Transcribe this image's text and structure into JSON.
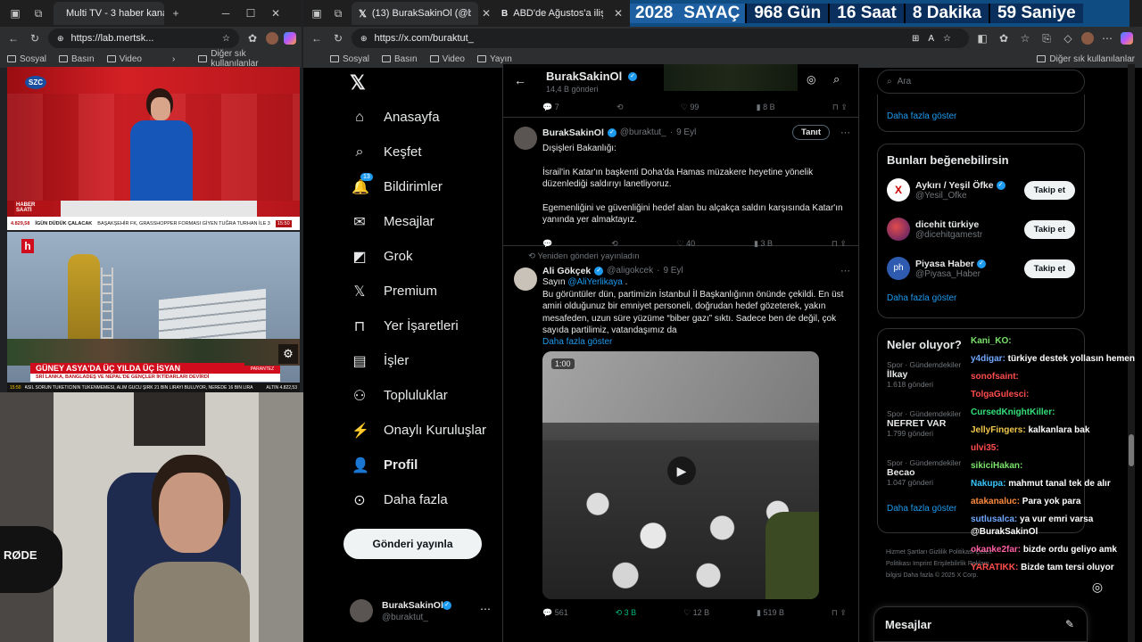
{
  "left_window": {
    "tabs": [
      {
        "label": "Multi TV - 3 haber kanal..."
      }
    ],
    "url": "https://lab.mertsk...",
    "bookmarks": [
      "Sosyal",
      "Basın",
      "Video"
    ],
    "bookmarks_more": "Diğer sık kullanılanlar",
    "tv1": {
      "logo": "SZC",
      "corner_label": "HABER SAATİ",
      "ticker": "İGÜN DÜDÜK ÇALACAK",
      "ticker2": "BAŞAKŞEHİR FK, GRASSHOPPER FORMASI GİYEN TUĞRA TURHAN İLE 3",
      "time": "15:50",
      "index": "4.829,58"
    },
    "tv2": {
      "headline": "GÜNEY ASYA'DA ÜÇ YILDA ÜÇ İSYAN",
      "subhead": "SRİ LANKA, BANGLADEŞ VE NEPAL'DE GENÇLER İKTİDARLARI DEVİRDİ",
      "ticker": "ASIL SORUN TÜKETİCİNİN TÜKENMEMESİ, ALIM GÜCÜ ŞİRK 21 BİN LİRAYI BULUYOR, NEREDE 16 BİN LİRA",
      "time": "15:50",
      "label": "PARANTEZ",
      "gold": "ALTIN 4.822,53"
    },
    "webcam_label": "RØDE"
  },
  "right_window": {
    "tabs": [
      {
        "label": "(13) BurakSakinOl (@buraktut_"
      },
      {
        "label": "ABD'de Ağustos'a ilişkin enfla"
      }
    ],
    "url": "https://x.com/buraktut_",
    "bookmarks": [
      "Sosyal",
      "Basın",
      "Video",
      "Yayın"
    ],
    "bookmarks_more": "Diğer sık kullanılanlar"
  },
  "counter": {
    "year": "2028",
    "label": "SAYAÇ",
    "days": "968 Gün",
    "hours": "16 Saat",
    "minutes": "8 Dakika",
    "seconds": "59 Saniye"
  },
  "x_nav": {
    "items": [
      {
        "label": "Anasayfa",
        "icon": "home-icon"
      },
      {
        "label": "Keşfet",
        "icon": "search-icon"
      },
      {
        "label": "Bildirimler",
        "icon": "bell-icon",
        "badge": "13"
      },
      {
        "label": "Mesajlar",
        "icon": "mail-icon"
      },
      {
        "label": "Grok",
        "icon": "grok-icon"
      },
      {
        "label": "Premium",
        "icon": "x-icon"
      },
      {
        "label": "Yer İşaretleri",
        "icon": "bookmark-icon"
      },
      {
        "label": "İşler",
        "icon": "briefcase-icon"
      },
      {
        "label": "Topluluklar",
        "icon": "people-icon"
      },
      {
        "label": "Onaylı Kuruluşlar",
        "icon": "lightning-icon"
      },
      {
        "label": "Profil",
        "icon": "person-icon"
      },
      {
        "label": "Daha fazla",
        "icon": "more-icon"
      }
    ],
    "post_button": "Gönderi yayınla",
    "account_name": "BurakSakinOl",
    "account_handle": "@buraktut_"
  },
  "profile_header": {
    "name": "BurakSakinOl",
    "post_count": "14,4 B gönderi"
  },
  "top_actions": {
    "replies": "7",
    "likes": "99",
    "views": "8 B"
  },
  "post1": {
    "name": "BurakSakinOl",
    "handle": "@buraktut_",
    "date": "9 Eyl",
    "button": "Tanıt",
    "line1": "Dışişleri Bakanlığı:",
    "line2": "İsrail'in Katar'ın başkenti Doha'da Hamas müzakere heyetine yönelik düzenlediği saldırıyı lanetliyoruz.",
    "line3": "Egemenliğini ve güvenliğini hedef alan bu alçakça saldırı karşısında Katar'ın yanında yer almaktayız.",
    "likes": "40",
    "views": "3 B"
  },
  "post2": {
    "repost_label": "Yeniden gönderi yayınladın",
    "name": "Ali Gökçek",
    "handle": "@aligokcek",
    "date": "9 Eyl",
    "line1_pre": "Sayın ",
    "mention": "@AliYerlikaya",
    "line1_post": " .",
    "body": "Bu görüntüler dün, partimizin İstanbul İl Başkanlığının önünde çekildi. En üst amiri olduğunuz bir emniyet personeli, doğrudan hedef gözeterek, yakın mesafeden, uzun süre yüzüme “biber gazı” sıktı. Sadece ben de değil, çok sayıda partilimiz, vatandaşımız da",
    "show_more": "Daha fazla göster",
    "video_time": "1:00",
    "replies": "561",
    "reposts": "3 B",
    "likes": "12 B",
    "views": "519 B"
  },
  "sidebar": {
    "search_placeholder": "Ara",
    "show_more": "Daha fazla göster",
    "suggest_title": "Bunları beğenebilirsin",
    "suggestions": [
      {
        "name": "Aykırı / Yeşil Öfke",
        "handle": "@Yesil_Ofke",
        "button": "Takip et"
      },
      {
        "name": "dicehit türkiye",
        "handle": "@dicehitgamestr",
        "button": "Takip et"
      },
      {
        "name": "Piyasa Haber",
        "handle": "@Piyasa_Haber",
        "button": "Takip et"
      }
    ],
    "suggest_more": "Daha fazla göster",
    "trends_title": "Neler oluyor?",
    "trends": [
      {
        "category": "Spor · Gündemdekiler",
        "name": "İlkay",
        "count": "1.618 gönderi"
      },
      {
        "category": "Spor · Gündemdekiler",
        "name": "NEFRET VAR",
        "count": "1.799 gönderi"
      },
      {
        "category": "Spor · Gündemdekiler",
        "name": "Becao",
        "count": "1.047 gönderi"
      }
    ],
    "trends_more": "Daha fazla göster",
    "footer": [
      "Hizmet Şartları",
      "Gizlilik Politikası",
      "Çerez Politikası",
      "Imprint",
      "Erişilebilirlik",
      "Reklam bilgisi",
      "Daha fazla",
      "© 2025 X Corp."
    ],
    "messages_label": "Mesajlar"
  },
  "chat": [
    {
      "user": "Kani_KO:",
      "msg": "",
      "color": "#7be36b"
    },
    {
      "user": "y4digar:",
      "msg": "türkiye destek yollasın hemen",
      "color": "#6fa8ff"
    },
    {
      "user": "sonofsaint:",
      "msg": "",
      "color": "#ff4d4d"
    },
    {
      "user": "TolgaGulesci:",
      "msg": "",
      "color": "#ff4d4d"
    },
    {
      "user": "CursedKnightKiller:",
      "msg": "",
      "color": "#33e07a"
    },
    {
      "user": "JellyFingers:",
      "msg": "kalkanlara bak",
      "color": "#f2c94c"
    },
    {
      "user": "ulvi35:",
      "msg": "",
      "color": "#ff4d4d"
    },
    {
      "user": "sikiciHakan:",
      "msg": "",
      "color": "#7be36b"
    },
    {
      "user": "Nakupa:",
      "msg": "mahmut tanal tek de alır",
      "color": "#38c7ff"
    },
    {
      "user": "atakanaluc:",
      "msg": "Para yok para",
      "color": "#ff8a3d"
    },
    {
      "user": "sutlusalca:",
      "msg": "ya vur emri varsa @BurakSakinOl",
      "color": "#6fa8ff"
    },
    {
      "user": "okanke2far:",
      "msg": "bizde ordu geliyo amk",
      "color": "#ff5fa2"
    },
    {
      "user": "YARATIKK:",
      "msg": "Bizde tam tersi oluyor",
      "color": "#ff4d4d"
    }
  ]
}
